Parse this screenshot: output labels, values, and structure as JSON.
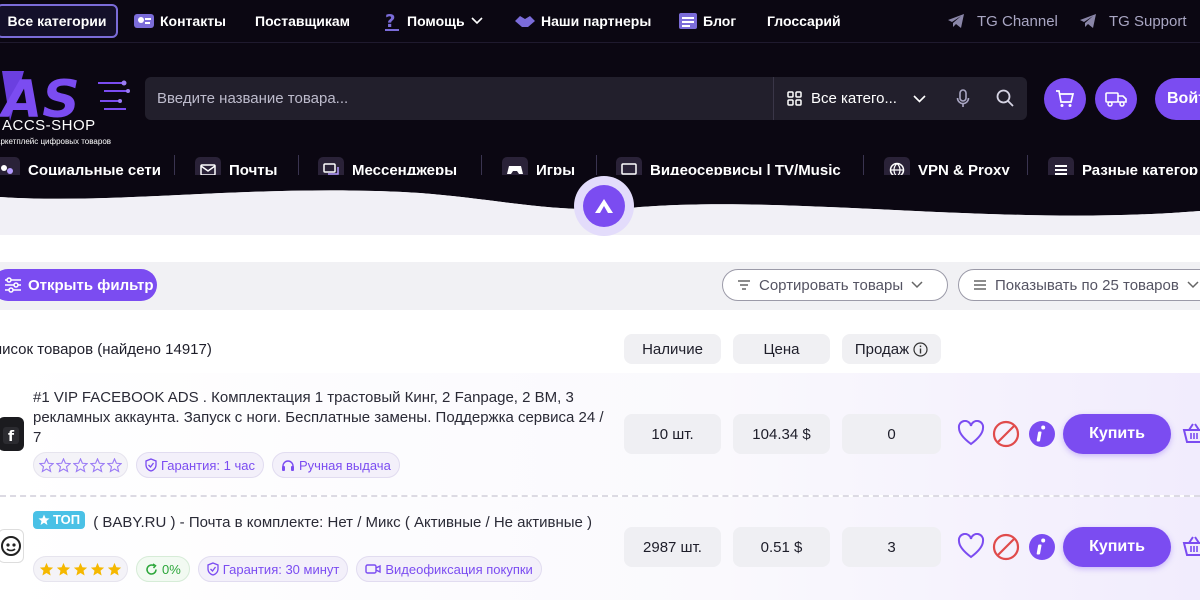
{
  "topnav": {
    "all_categories": "Все категории",
    "contacts": "Контакты",
    "suppliers": "Поставщикам",
    "help": "Помощь",
    "partners": "Наши партнеры",
    "blog": "Блог",
    "glossary": "Глоссарий",
    "tg_channel": "TG Channel",
    "tg_support": "TG Support"
  },
  "header": {
    "logo_text": "ACCS-SHOP",
    "logo_subtitle": "аркетплейс цифровых товаров",
    "search_placeholder": "Введите название товара...",
    "category_select": "Все катего...",
    "login_label": "Войт"
  },
  "categories": [
    {
      "label": "Социальные сети",
      "icon": "social-icon"
    },
    {
      "label": "Почты",
      "icon": "mail-icon"
    },
    {
      "label": "Мессенджеры",
      "icon": "chat-icon"
    },
    {
      "label": "Игры",
      "icon": "gamepad-icon"
    },
    {
      "label": "Видеосервисы | TV/Music",
      "icon": "tv-icon"
    },
    {
      "label": "VPN & Proxy",
      "icon": "vpn-icon"
    },
    {
      "label": "Разные категор",
      "icon": "list-icon"
    }
  ],
  "filterbar": {
    "open_filter": "Открыть фильтр",
    "sort_label": "Сортировать товары",
    "per_page_label": "Показывать по 25 товаров"
  },
  "list": {
    "title": "писок товаров (найдено 14917)",
    "col_stock": "Наличие",
    "col_price": "Цена",
    "col_sales": "Продаж"
  },
  "products": [
    {
      "title": "#1 VIP FACEBOOK ADS . Комплектация 1 трастовый Кинг, 2 Fanpage, 2 BM, 3 рекламных аккаунта. Запуск с ноги. Бесплатные замены. Поддержка сервиса 24 / 7",
      "top_badge": "",
      "rating": 0,
      "tags": [
        "Гарантия: 1 час",
        "Ручная выдача"
      ],
      "stock": "10 шт.",
      "price": "104.34 $",
      "sales": "0",
      "buy_label": "Купить"
    },
    {
      "title": "( BABY.RU ) - Почта в комплекте: Нет / Микс ( Активные / Не активные )",
      "top_badge": "ТОП",
      "rating": 5,
      "refund_pct": "0%",
      "tags": [
        "Гарантия: 30 минут",
        "Видеофиксация покупки"
      ],
      "stock": "2987 шт.",
      "price": "0.51 $",
      "sales": "3",
      "buy_label": "Купить"
    }
  ],
  "colors": {
    "accent": "#7b4cf1",
    "dark_bg": "#0b0712",
    "star_gold": "#f5b800",
    "danger": "#e04b4b",
    "top_badge": "#4ac1e6"
  }
}
